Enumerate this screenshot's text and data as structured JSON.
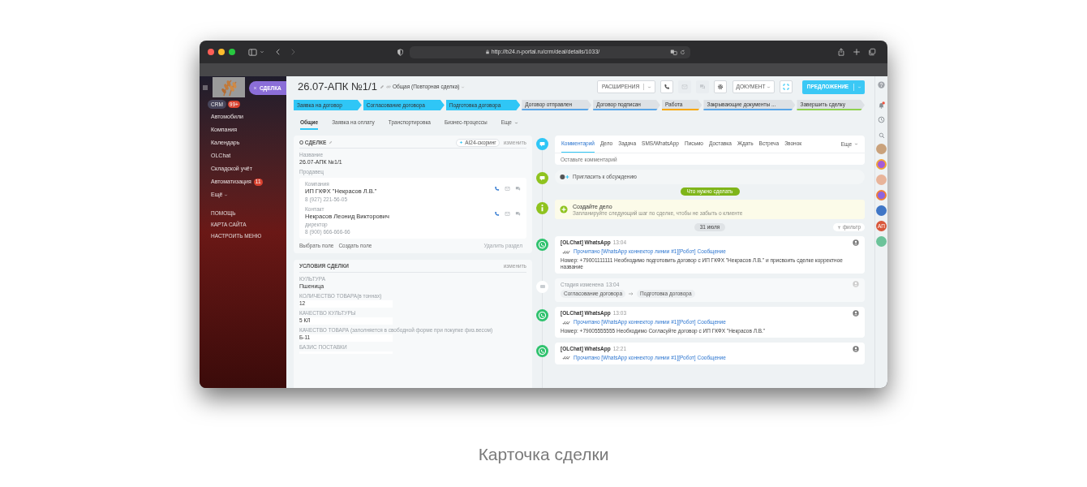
{
  "browser": {
    "url": "http://b24.n-portal.ru/crm/deal/details/1033/"
  },
  "sidebar": {
    "deal_button": "СДЕЛКА",
    "crm": {
      "label": "CRM",
      "badge": "99+"
    },
    "items": [
      {
        "label": "Автомобили"
      },
      {
        "label": "Компания"
      },
      {
        "label": "Календарь"
      },
      {
        "label": "OLChat"
      },
      {
        "label": "Складской учёт"
      },
      {
        "label": "Автоматизация",
        "badge": "11"
      },
      {
        "label": "Ещё",
        "expandable": true
      }
    ],
    "links": [
      "ПОМОЩЬ",
      "КАРТА САЙТА",
      "НАСТРОИТЬ МЕНЮ"
    ]
  },
  "header": {
    "title": "26.07-АПК №1/1",
    "category": "Общая (Повторная сделка)",
    "extensions_button": "РАСШИРЕНИЯ",
    "document_button": "ДОКУМЕНТ",
    "offer_button": "ПРЕДЛОЖЕНИЕ"
  },
  "stages": [
    {
      "label": "Заявка на договор",
      "passed": true,
      "color": "#2fc6f6"
    },
    {
      "label": "Согласование договора",
      "passed": true,
      "color": "#2fc6f6"
    },
    {
      "label": "Подготовка договора",
      "passed": true,
      "color": "#2fc6f6"
    },
    {
      "label": "Договор отправлен",
      "passed": false,
      "color": "#5aa6e8"
    },
    {
      "label": "Договор подписан",
      "passed": false,
      "color": "#5aa6e8"
    },
    {
      "label": "Работа",
      "passed": false,
      "color": "#f7a700"
    },
    {
      "label": "Закрывающие документы ...",
      "passed": false,
      "color": "#5aa6e8"
    },
    {
      "label": "Завершить сделку",
      "passed": false,
      "color": "#8fd14f"
    }
  ],
  "tabs": [
    {
      "label": "Общие",
      "selected": true
    },
    {
      "label": "Заявка на оплату",
      "selected": false
    },
    {
      "label": "Транспортировка",
      "selected": false
    },
    {
      "label": "Бизнес-процессы",
      "selected": false
    },
    {
      "label": "Еще",
      "selected": false
    }
  ],
  "about_card": {
    "title": "О СДЕЛКЕ",
    "ai_badge": "AI24-скоринг",
    "change": "изменить",
    "name_label": "Название",
    "name_value": "26.07-АПК №1/1",
    "seller_label": "Продавец",
    "contacts": [
      {
        "role": "Компания",
        "name": "ИП ГКФХ \"Некрасов Л.В.\"",
        "phone": "8 (927) 221-56-05"
      },
      {
        "role": "Контакт",
        "name": "Некрасов Леонид Викторович",
        "position": "директор",
        "phone": "8 (900) 666-666-66"
      }
    ],
    "actions": [
      "Выбрать поле",
      "Создать поле"
    ],
    "delete": "Удалить раздел"
  },
  "terms_card": {
    "title": "УСЛОВИЯ СДЕЛКИ",
    "change": "изменить",
    "fields": [
      {
        "label": "КУЛЬТУРА",
        "value": "Пшеница",
        "kind": "text"
      },
      {
        "label": "КОЛИЧЕСТВО ТОВАРА(в тоннах)",
        "value": "12",
        "kind": "field"
      },
      {
        "label": "КАЧЕСТВО КУЛЬТУРЫ",
        "value": "5 КЛ",
        "kind": "field"
      },
      {
        "label": "КАЧЕСТВО ТОВАРА (заполняется в свободной форме при покупке физ.весом)",
        "value": "Б-11",
        "kind": "field"
      },
      {
        "label": "БАЗИС ПОСТАВКИ",
        "kind": "field"
      }
    ]
  },
  "composer": {
    "tabs": [
      {
        "label": "Комментарий",
        "selected": true
      },
      {
        "label": "Дело",
        "selected": false
      },
      {
        "label": "Задача",
        "selected": false
      },
      {
        "label": "SMS/WhatsApp",
        "selected": false
      },
      {
        "label": "Письмо",
        "selected": false
      },
      {
        "label": "Доставка",
        "selected": false
      },
      {
        "label": "Ждать",
        "selected": false
      },
      {
        "label": "Встреча",
        "selected": false
      },
      {
        "label": "Звонок",
        "selected": false
      }
    ],
    "more": "Еще",
    "placeholder": "Оставьте комментарий"
  },
  "invite": "Пригласить к обсуждению",
  "todo_label": "Что нужно сделать",
  "create_task": {
    "title": "Создайте дело",
    "hint": "Запланируйте следующий шаг по сделке, чтобы не забыть о клиенте"
  },
  "date": "31 июля",
  "filter": "фильтр",
  "events": [
    {
      "kind": "message",
      "source": "[OLChat] WhatsApp",
      "time": "13:04",
      "link": "Прочитано [WhatsApp коннектор линии #1][Робот] Сообщение",
      "text": "Номер: +79001111111 Необходимо подготовить договор с ИП ГКФХ \"Некрасов Л.В.\" и присвоить сделке корректное название"
    },
    {
      "kind": "stage",
      "title": "Стадия изменена",
      "time": "13:04",
      "from": "Согласование договора",
      "to": "Подготовка договора"
    },
    {
      "kind": "message",
      "source": "[OLChat] WhatsApp",
      "time": "13:03",
      "link": "Прочитано [WhatsApp коннектор линии #1][Робот] Сообщение",
      "text": "Номер: +79005555555 Необходимо Согласуйте договор с ИП ГКФХ \"Некрасов Л.В.\""
    },
    {
      "kind": "message",
      "source": "[OLChat] WhatsApp",
      "time": "12:21",
      "link": "Прочитано [WhatsApp коннектор линии #1][Робот] Сообщение"
    }
  ],
  "rail": {
    "initials": "АП"
  },
  "caption": "Карточка сделки"
}
